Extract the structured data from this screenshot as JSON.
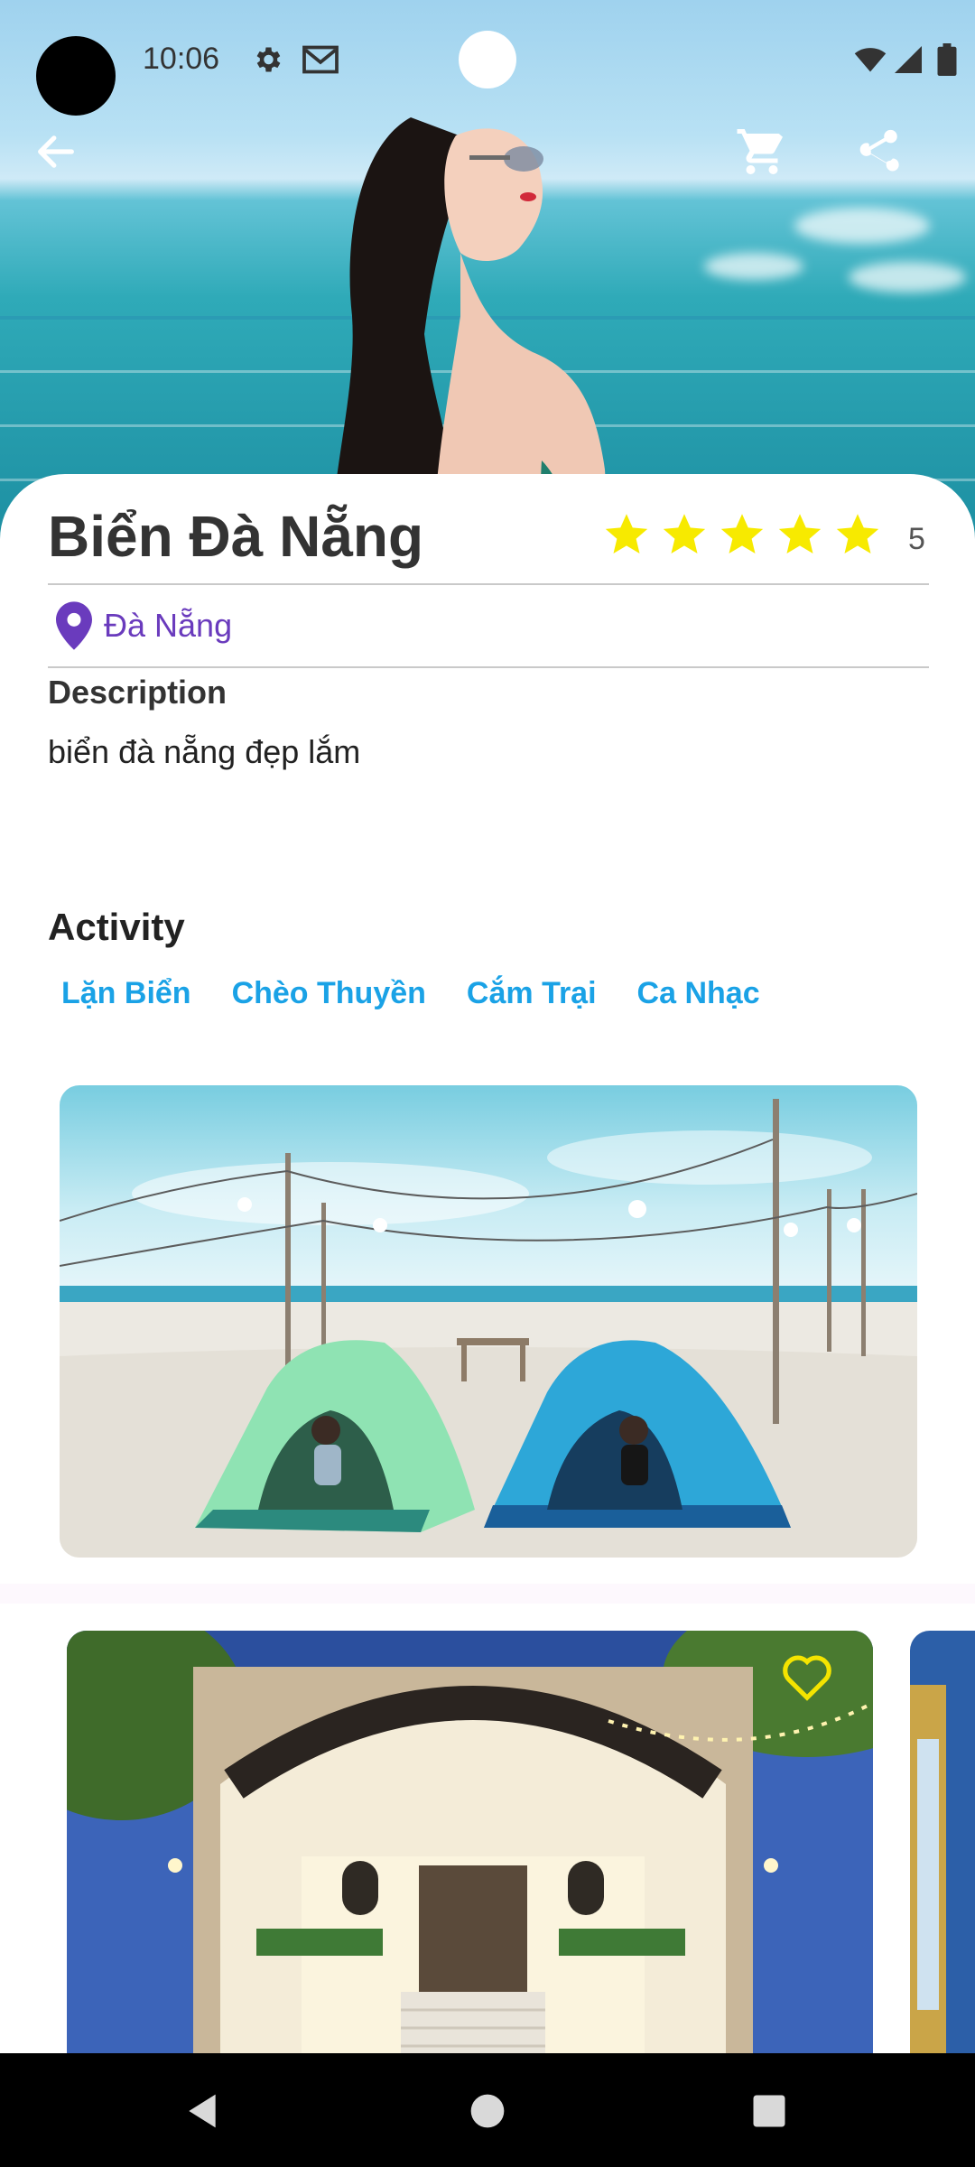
{
  "status_bar": {
    "time": "10:06",
    "icons": [
      "settings-icon",
      "gmail-icon",
      "wifi-icon",
      "signal-icon",
      "battery-icon"
    ]
  },
  "top_bar": {
    "back_icon": "arrow-left-icon",
    "cart_icon": "cart-icon",
    "share_icon": "share-icon"
  },
  "place": {
    "title": "Biển Đà Nẵng",
    "rating": 5,
    "rating_label": "5",
    "location": "Đà Nẵng",
    "description_heading": "Description",
    "description": "biển đà nẵng đẹp lắm"
  },
  "activity": {
    "heading": "Activity",
    "items": [
      {
        "label": "Lặn Biển"
      },
      {
        "label": "Chèo Thuyền"
      },
      {
        "label": "Cắm Trại"
      },
      {
        "label": "Ca Nhạc"
      }
    ]
  },
  "colors": {
    "accent_purple": "#6a3bbd",
    "chip_blue": "#1aa2e6",
    "star_yellow": "#f7ea00",
    "heart_yellow": "#f4e400"
  },
  "nav_bar": {
    "icons": [
      "back-triangle-icon",
      "home-circle-icon",
      "recents-square-icon"
    ]
  }
}
